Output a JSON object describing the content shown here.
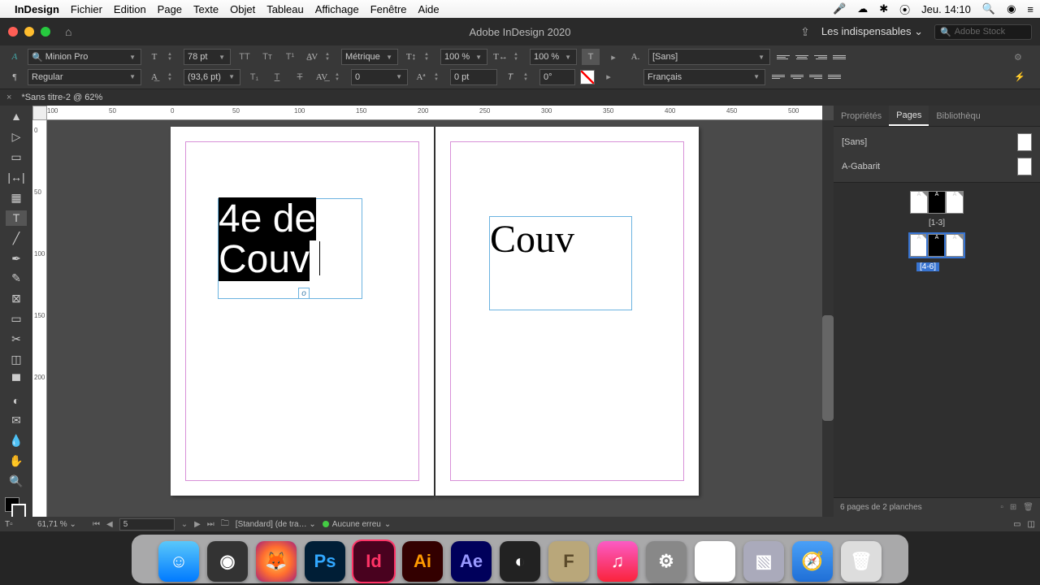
{
  "menubar": {
    "app": "InDesign",
    "items": [
      "Fichier",
      "Edition",
      "Page",
      "Texte",
      "Objet",
      "Tableau",
      "Affichage",
      "Fenêtre",
      "Aide"
    ],
    "clock": "Jeu. 14:10"
  },
  "titlebar": {
    "title": "Adobe InDesign 2020",
    "workspace": "Les indispensables",
    "stock_placeholder": "Adobe Stock"
  },
  "controls": {
    "font": "Minion Pro",
    "style": "Regular",
    "size": "78 pt",
    "leading": "(93,6 pt)",
    "kerning": "Métrique",
    "tracking": "0",
    "vscale": "100 %",
    "hscale": "100 %",
    "baseline": "0 pt",
    "skew": "0°",
    "char_style": "[Sans]",
    "language": "Français"
  },
  "document": {
    "tab_label": "*Sans titre-2 @ 62%",
    "ruler_h": [
      "100",
      "50",
      "0",
      "50",
      "100",
      "150",
      "200",
      "250",
      "300",
      "350",
      "400",
      "450",
      "500"
    ],
    "ruler_v": [
      "0",
      "50",
      "100",
      "150",
      "200"
    ],
    "left_text_line1": "4e de",
    "left_text_line2": "Couv",
    "right_text": "Couv",
    "overflow_mark": "o"
  },
  "panels": {
    "tabs": [
      "Propriétés",
      "Pages",
      "Bibliothèqu"
    ],
    "masters": [
      {
        "name": "[Sans]"
      },
      {
        "name": "A-Gabarit"
      }
    ],
    "spreads": [
      {
        "label": "[1-3]",
        "selected": false
      },
      {
        "label": "[4-6]",
        "selected": true
      }
    ],
    "footer": "6 pages de 2 planches"
  },
  "status": {
    "zoom": "61,71 %",
    "page": "5",
    "preset": "[Standard] (de tra…",
    "preflight": "Aucune erreu"
  },
  "dock": {
    "items": [
      {
        "name": "finder",
        "label": ""
      },
      {
        "name": "launchpad",
        "label": "◉"
      },
      {
        "name": "firefox",
        "label": ""
      },
      {
        "name": "photoshop",
        "label": "Ps"
      },
      {
        "name": "indesign",
        "label": "Id"
      },
      {
        "name": "illustrator",
        "label": "Ai"
      },
      {
        "name": "aftereffects",
        "label": "Ae"
      },
      {
        "name": "cinema4d",
        "label": "◐"
      },
      {
        "name": "font",
        "label": "F"
      },
      {
        "name": "music",
        "label": "♫"
      },
      {
        "name": "preferences",
        "label": "⚙"
      },
      {
        "name": "chrome",
        "label": "◉"
      },
      {
        "name": "preview",
        "label": "▧"
      },
      {
        "name": "safari",
        "label": "🧭"
      },
      {
        "name": "trash",
        "label": "🗑"
      }
    ]
  }
}
